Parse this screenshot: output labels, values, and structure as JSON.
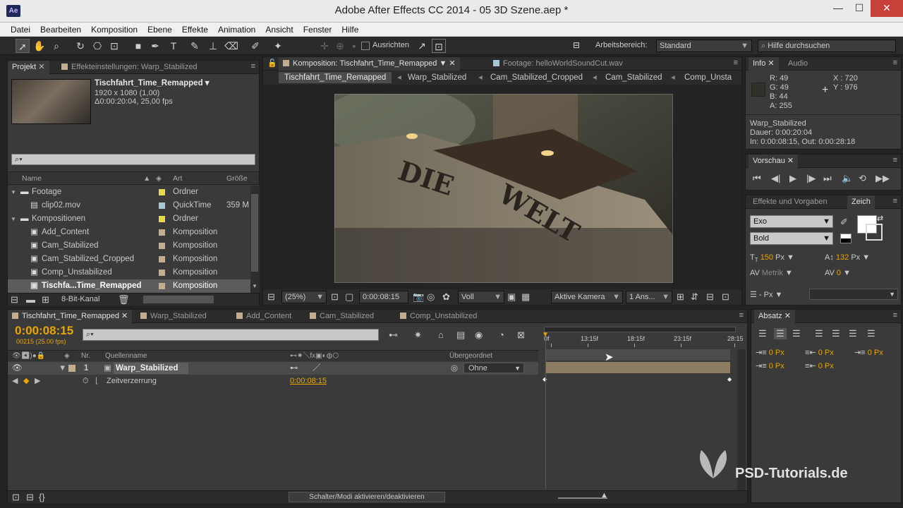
{
  "titlebar": {
    "app_icon": "Ae",
    "title": "Adobe After Effects CC 2014 - 05 3D Szene.aep *",
    "minimize": "—",
    "maximize": "☐",
    "close": "✕"
  },
  "menu": [
    "Datei",
    "Bearbeiten",
    "Komposition",
    "Ebene",
    "Effekte",
    "Animation",
    "Ansicht",
    "Fenster",
    "Hilfe"
  ],
  "toolbar": {
    "align_label": "Ausrichten",
    "workspace_label": "Arbeitsbereich:",
    "workspace_value": "Standard",
    "search_placeholder": "Hilfe durchsuchen"
  },
  "project": {
    "tabs": [
      "Projekt",
      "Effekteinstellungen: Warp_Stabilized"
    ],
    "item_name": "Tischfahrt_Time_Remapped",
    "item_res": "1920 x 1080 (1,00)",
    "item_dur": "Δ0:00:20:04, 25,00 fps",
    "columns": [
      "Name",
      "Art",
      "Größe"
    ],
    "rows": [
      {
        "name": "Footage",
        "type": "Ordner",
        "size": "",
        "kind": "folder",
        "indent": 0,
        "color": "#e6d84a"
      },
      {
        "name": "clip02.mov",
        "type": "QuickTime",
        "size": "359 M",
        "kind": "file",
        "indent": 1,
        "color": "#a7c7d6"
      },
      {
        "name": "Kompositionen",
        "type": "Ordner",
        "size": "",
        "kind": "folder",
        "indent": 0,
        "color": "#e6d84a"
      },
      {
        "name": "Add_Content",
        "type": "Komposition",
        "size": "",
        "kind": "comp",
        "indent": 1,
        "color": "#c4ad8f"
      },
      {
        "name": "Cam_Stabilized",
        "type": "Komposition",
        "size": "",
        "kind": "comp",
        "indent": 1,
        "color": "#c4ad8f"
      },
      {
        "name": "Cam_Stabilized_Cropped",
        "type": "Komposition",
        "size": "",
        "kind": "comp",
        "indent": 1,
        "color": "#c4ad8f"
      },
      {
        "name": "Comp_Unstabilized",
        "type": "Komposition",
        "size": "",
        "kind": "comp",
        "indent": 1,
        "color": "#c4ad8f"
      },
      {
        "name": "Tischfa...Time_Remapped",
        "type": "Komposition",
        "size": "",
        "kind": "comp",
        "indent": 1,
        "color": "#c4ad8f",
        "selected": true
      }
    ],
    "bit_depth": "8-Bit-Kanal"
  },
  "composition": {
    "tabs": [
      "Komposition: Tischfahrt_Time_Remapped",
      "Footage: helloWorldSoundCut.wav"
    ],
    "breadcrumbs": [
      "Tischfahrt_Time_Remapped",
      "Warp_Stabilized",
      "Cam_Stabilized_Cropped",
      "Cam_Stabilized",
      "Comp_Unsta"
    ],
    "zoom": "(25%)",
    "timecode": "0:00:08:15",
    "resolution": "Voll",
    "camera": "Aktive Kamera",
    "views": "1 Ans..."
  },
  "info": {
    "tabs": [
      "Info",
      "Audio"
    ],
    "r": "49",
    "g": "49",
    "b": "44",
    "a": "255",
    "x": "720",
    "y": "976",
    "layer": "Warp_Stabilized",
    "duration": "Dauer: 0:00:20:04",
    "inout": "In: 0:00:08:15, Out: 0:00:28:18"
  },
  "preview": {
    "tab": "Vorschau"
  },
  "effects": {
    "tabs": [
      "Effekte und Vorgaben",
      "Zeich"
    ]
  },
  "character": {
    "font": "Exo",
    "style": "Bold",
    "size": "150",
    "size_unit": "Px",
    "leading": "132",
    "leading_unit": "Px",
    "kerning": "Metrik",
    "tracking": "0",
    "stroke": "- Px"
  },
  "paragraph": {
    "tab": "Absatz",
    "values": [
      "0 Px",
      "0 Px",
      "0 Px",
      "0 Px",
      "0 Px"
    ]
  },
  "timeline": {
    "tabs": [
      "Tischfahrt_Time_Remapped",
      "Warp_Stabilized",
      "Add_Content",
      "Cam_Stabilized",
      "Comp_Unstabilized"
    ],
    "timecode": "0:00:08:15",
    "frames": "00215 (25.00 fps)",
    "columns": {
      "nr": "Nr.",
      "name": "Quellenname",
      "parent": "Übergeordnet"
    },
    "layer": {
      "nr": "1",
      "name": "Warp_Stabilized",
      "parent": "Ohne"
    },
    "property": {
      "name": "Zeitverzerrung",
      "value": "0:00:08:15"
    },
    "ruler": [
      "0f",
      "13:15f",
      "18:15f",
      "23:15f",
      "28:15"
    ],
    "toggle_label": "Schalter/Modi aktivieren/deaktivieren"
  },
  "watermark": "PSD-Tutorials.de"
}
